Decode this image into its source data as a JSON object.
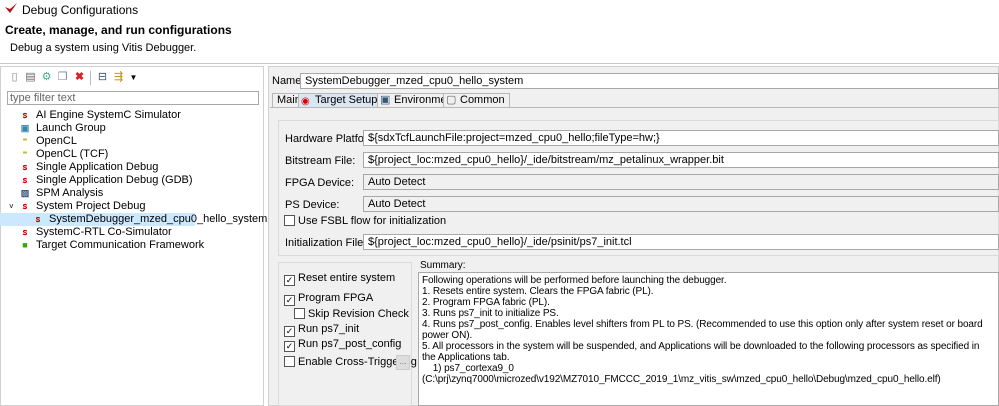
{
  "window": {
    "title": "Debug Configurations",
    "heading": "Create, manage, and run configurations",
    "subtitle": "Debug a system using Vitis Debugger."
  },
  "toolbar": {
    "icons": [
      "new-config-icon",
      "new-prototype-icon",
      "export-icon",
      "duplicate-icon",
      "delete-icon",
      "collapse-all-icon",
      "filter-icon",
      "dropdown-icon"
    ]
  },
  "filter": {
    "placeholder": "type filter text"
  },
  "tree": [
    {
      "label": "AI Engine SystemC Simulator",
      "icon": "tcf-icon"
    },
    {
      "label": "Launch Group",
      "icon": "launch-group-icon"
    },
    {
      "label": "OpenCL",
      "icon": "opencl-icon"
    },
    {
      "label": "OpenCL (TCF)",
      "icon": "opencl-icon"
    },
    {
      "label": "Single Application Debug",
      "icon": "tcf-icon"
    },
    {
      "label": "Single Application Debug (GDB)",
      "icon": "gdb-icon"
    },
    {
      "label": "SPM Analysis",
      "icon": "spm-icon"
    },
    {
      "label": "System Project Debug",
      "icon": "tcf-icon"
    },
    {
      "label": "SystemDebugger_mzed_cpu0_hello_system",
      "icon": "tcf-icon"
    },
    {
      "label": "SystemC-RTL Co-Simulator",
      "icon": "tcf-icon"
    },
    {
      "label": "Target Communication Framework",
      "icon": "tcf-framework-icon"
    }
  ],
  "config": {
    "name_label": "Name:",
    "name": "SystemDebugger_mzed_cpu0_hello_system",
    "tabs": [
      "Main",
      "Target Setup",
      "Environment",
      "Common"
    ],
    "hw_label": "Hardware Platform:",
    "hw": "${sdxTcfLaunchFile:project=mzed_cpu0_hello;fileType=hw;}",
    "bit_label": "Bitstream File:",
    "bit": "${project_loc:mzed_cpu0_hello}/_ide/bitstream/mz_petalinux_wrapper.bit",
    "fpga_label": "FPGA Device:",
    "fpga": "Auto Detect",
    "ps_label": "PS Device:",
    "ps": "Auto Detect",
    "fsbl_label": "Use FSBL flow for initialization",
    "init_label": "Initialization File:",
    "init": "${project_loc:mzed_cpu0_hello}/_ide/psinit/ps7_init.tcl",
    "options": [
      {
        "label": "Reset entire system",
        "checked": true
      },
      {
        "label": "Program FPGA",
        "checked": true
      },
      {
        "label": "Skip Revision Check",
        "checked": false
      },
      {
        "label": "Run ps7_init",
        "checked": true
      },
      {
        "label": "Run ps7_post_config",
        "checked": true
      },
      {
        "label": "Enable Cross-Triggering",
        "checked": false
      }
    ],
    "cross_btn": "...",
    "summary_label": "Summary:",
    "summary": [
      "Following operations will be performed before launching the debugger.",
      "1. Resets entire system. Clears the FPGA fabric (PL).",
      "2. Program FPGA fabric (PL).",
      "3. Runs ps7_init to initialize PS.",
      "4. Runs ps7_post_config. Enables level shifters from PL to PS. (Recommended to use this option only after system reset or board power ON).",
      "5. All processors in the system will be suspended, and Applications will be downloaded to the following processors as specified in the Applications tab.",
      "    1) ps7_cortexa9_0 (C:\\prj\\zynq7000\\microzed\\v192\\MZ7010_FMCCC_2019_1\\mz_vitis_sw\\mzed_cpu0_hello\\Debug\\mzed_cpu0_hello.elf)"
    ]
  }
}
